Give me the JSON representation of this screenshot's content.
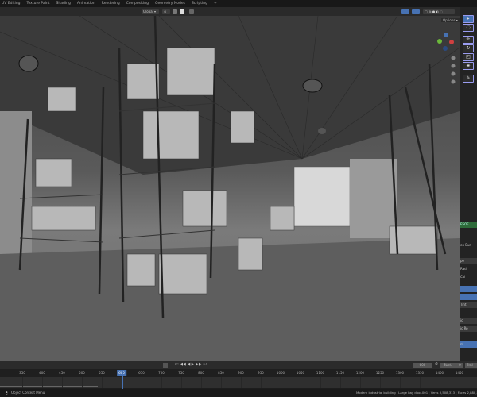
{
  "workspace_tabs": [
    "UV Editing",
    "Texture Paint",
    "Shading",
    "Animation",
    "Rendering",
    "Compositing",
    "Geometry Nodes",
    "Scripting",
    "+"
  ],
  "header": {
    "transform_orientation": "Global",
    "options_label": "Options"
  },
  "toolbar": {
    "tools": [
      {
        "icon": "select-box-icon",
        "active": true
      },
      {
        "icon": "cursor-icon"
      },
      {
        "icon": "move-icon"
      },
      {
        "icon": "rotate-icon"
      },
      {
        "icon": "scale-icon"
      },
      {
        "icon": "transform-icon"
      },
      {
        "icon": "annotate-icon"
      }
    ]
  },
  "properties_fragments": [
    "ESOF",
    "en Burl",
    "pe",
    "Radi",
    "Col",
    "Tint",
    "ic",
    "ic Ro",
    "nt"
  ],
  "accent_color": "#4772b3",
  "timeline": {
    "current_frame": "600",
    "frame_display": "600",
    "start_label": "Start",
    "start_value": "0",
    "end_label": "End",
    "ticks": [
      "350",
      "400",
      "450",
      "500",
      "550",
      "600",
      "650",
      "700",
      "750",
      "800",
      "850",
      "900",
      "950",
      "1000",
      "1050",
      "1100",
      "1150",
      "1200",
      "1250",
      "1300",
      "1350",
      "1400",
      "1450"
    ]
  },
  "status": {
    "left": "Object Context Menu",
    "right": "Modern industrial building | Large bay door.001 | Verts 3,508,313 | Faces 2,880,573 | T"
  }
}
